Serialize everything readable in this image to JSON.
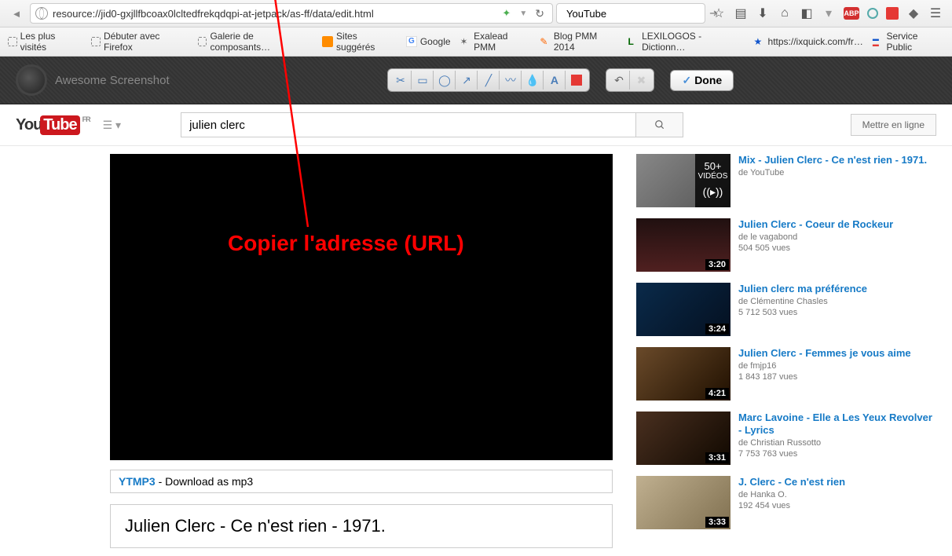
{
  "browser": {
    "url": "resource://jid0-gxjllfbcoax0lcltedfrekqdqpi-at-jetpack/as-ff/data/edit.html",
    "search_engine": "YouTube"
  },
  "bookmarks": [
    {
      "label": "Les plus visités",
      "icon": "dot"
    },
    {
      "label": "Débuter avec Firefox",
      "icon": "dot"
    },
    {
      "label": "Galerie de composants…",
      "icon": "dot"
    },
    {
      "label": "Sites suggérés",
      "icon": "orange",
      "color": "#ff8c00"
    },
    {
      "label": "Google",
      "icon": "g",
      "color": "#4285f4"
    },
    {
      "label": "Exalead PMM",
      "icon": "ex"
    },
    {
      "label": "Blog PMM 2014",
      "icon": "pencil",
      "color": "#ff6600"
    },
    {
      "label": "LEXILOGOS - Dictionn…",
      "icon": "L",
      "color": "#006600"
    },
    {
      "label": "https://ixquick.com/fr…",
      "icon": "star",
      "color": "#1155cc"
    },
    {
      "label": "Service Public",
      "icon": "sp"
    }
  ],
  "as_toolbar": {
    "name": "Awesome Screenshot",
    "done": "Done"
  },
  "youtube": {
    "region": "FR",
    "search_value": "julien clerc",
    "upload_label": "Mettre en ligne"
  },
  "annotation": "Copier l'adresse (URL)",
  "ytmp3": {
    "brand": "YTMP3",
    "rest": " - Download as mp3"
  },
  "video_title": "Julien Clerc - Ce n'est rien - 1971.",
  "sidebar": [
    {
      "title": "Mix - Julien Clerc - Ce n'est rien - 1971.",
      "author": "de YouTube",
      "views": "",
      "duration": "",
      "mix_count": "50+",
      "mix_label": "VIDÉOS",
      "bg": "linear-gradient(135deg,#888,#555)"
    },
    {
      "title": "Julien Clerc - Coeur de Rockeur",
      "author": "de le vagabond",
      "views": "504 505 vues",
      "duration": "3:20",
      "bg": "linear-gradient(0deg,#502020,#201010)"
    },
    {
      "title": "Julien clerc ma préférence",
      "author": "de Clémentine Chasles",
      "views": "5 712 503 vues",
      "duration": "3:24",
      "bg": "linear-gradient(135deg,#0a2a4a,#041020)"
    },
    {
      "title": "Julien Clerc - Femmes je vous aime",
      "author": "de fmjp16",
      "views": "1 843 187 vues",
      "duration": "4:21",
      "bg": "linear-gradient(135deg,#6a4a2a,#201000)"
    },
    {
      "title": "Marc Lavoine - Elle a Les Yeux Revolver - Lyrics",
      "author": "de Christian Russotto",
      "views": "7 753 763 vues",
      "duration": "3:31",
      "bg": "linear-gradient(135deg,#4a3020,#100800)"
    },
    {
      "title": "J. Clerc - Ce n'est rien",
      "author": "de Hanka O.",
      "views": "192 454 vues",
      "duration": "3:33",
      "bg": "linear-gradient(135deg,#c0b090,#807050)"
    }
  ]
}
